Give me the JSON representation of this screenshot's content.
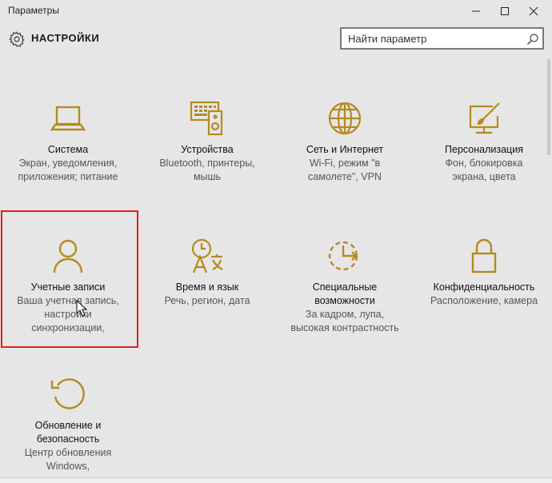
{
  "window": {
    "title": "Параметры",
    "minimize_label": "─",
    "maximize_label": "☐",
    "close_label": "✕"
  },
  "header": {
    "title": "НАСТРОЙКИ",
    "icon": "gear-icon"
  },
  "search": {
    "placeholder": "Найти параметр",
    "icon": "search-icon"
  },
  "colors": {
    "accent": "#b58a1e",
    "background": "#e6e6e6",
    "highlight": "#e02020"
  },
  "tiles": [
    {
      "icon": "laptop-icon",
      "name": "Система",
      "desc": [
        "Экран, уведомления,",
        "приложения; питание"
      ]
    },
    {
      "icon": "devices-icon",
      "name": "Устройства",
      "desc": [
        "Bluetooth, принтеры,",
        "мышь"
      ]
    },
    {
      "icon": "globe-icon",
      "name": "Сеть и Интернет",
      "desc": [
        "Wi-Fi, режим \"в",
        "самолете\", VPN"
      ]
    },
    {
      "icon": "personalization-icon",
      "name": "Персонализация",
      "desc": [
        "Фон, блокировка",
        "экрана, цвета"
      ]
    },
    {
      "icon": "person-icon",
      "name": "Учетные записи",
      "desc": [
        "Ваша учетная запись,",
        "настройки",
        "синхронизации,"
      ]
    },
    {
      "icon": "time-language-icon",
      "name": "Время и язык",
      "desc": [
        "Речь, регион, дата"
      ]
    },
    {
      "icon": "ease-of-access-icon",
      "name": [
        "Специальные",
        "возможности"
      ],
      "desc": [
        "За кадром, лупа,",
        "высокая контрастность"
      ]
    },
    {
      "icon": "lock-icon",
      "name": "Конфиденциальность",
      "desc": [
        "Расположение, камера"
      ]
    },
    {
      "icon": "update-icon",
      "name": [
        "Обновление и",
        "безопасность"
      ],
      "desc": [
        "Центр обновления",
        "Windows,"
      ]
    }
  ]
}
